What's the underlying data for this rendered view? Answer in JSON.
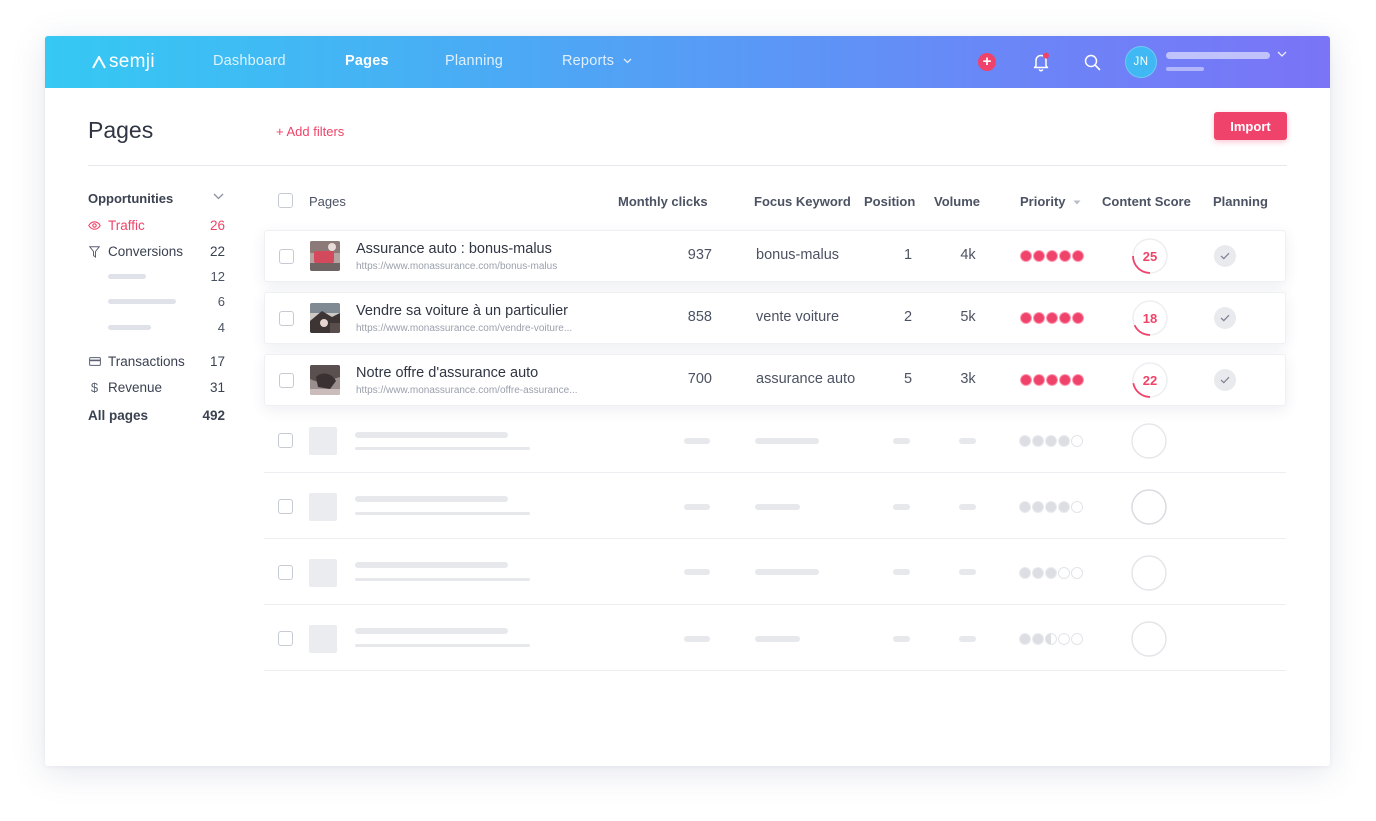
{
  "topbar": {
    "logo_text": "semji",
    "nav": [
      {
        "label": "Dashboard",
        "active": false
      },
      {
        "label": "Pages",
        "active": true
      },
      {
        "label": "Planning",
        "active": false
      },
      {
        "label": "Reports",
        "active": false,
        "has_dropdown": true
      }
    ],
    "user_initials": "JN",
    "add_icon": "plus-icon",
    "notification_icon": "bell-icon",
    "search_icon": "search-icon"
  },
  "header": {
    "title": "Pages",
    "add_filters": "+ Add filters",
    "import_label": "Import"
  },
  "sidebar": {
    "title": "Opportunities",
    "items": [
      {
        "label": "Traffic",
        "count": "26",
        "icon": "eye-icon",
        "active": true
      },
      {
        "label": "Conversions",
        "count": "22",
        "icon": "filter-icon",
        "active": false
      }
    ],
    "sub_counts": [
      "12",
      "6",
      "4"
    ],
    "items2": [
      {
        "label": "Transactions",
        "count": "17",
        "icon": "card-icon"
      },
      {
        "label": "Revenue",
        "count": "31",
        "icon": "dollar-icon"
      }
    ],
    "all_pages": {
      "label": "All pages",
      "count": "492"
    }
  },
  "table": {
    "columns": [
      "Pages",
      "Monthly clicks",
      "Focus Keyword",
      "Position",
      "Volume",
      "Priority",
      "Content Score",
      "Planning"
    ],
    "rows": [
      {
        "title": "Assurance auto : bonus-malus",
        "url": "https://www.monassurance.com/bonus-malus",
        "clicks": "937",
        "keyword": "bonus-malus",
        "position": "1",
        "volume": "4k",
        "priority": 5,
        "score": "25",
        "planned": true
      },
      {
        "title": "Vendre sa voiture à un particulier",
        "url": "https://www.monassurance.com/vendre-voiture...",
        "clicks": "858",
        "keyword": "vente voiture",
        "position": "2",
        "volume": "5k",
        "priority": 5,
        "score": "18",
        "planned": true
      },
      {
        "title": "Notre offre d'assurance auto",
        "url": "https://www.monassurance.com/offre-assurance...",
        "clicks": "700",
        "keyword": "assurance auto",
        "position": "5",
        "volume": "3k",
        "priority": 5,
        "score": "22",
        "planned": true
      }
    ],
    "placeholder_priority": [
      4,
      4,
      3,
      2.5
    ]
  },
  "colors": {
    "accent": "#f0436b",
    "gradient_start": "#35c9f3",
    "gradient_end": "#7a74f7"
  }
}
